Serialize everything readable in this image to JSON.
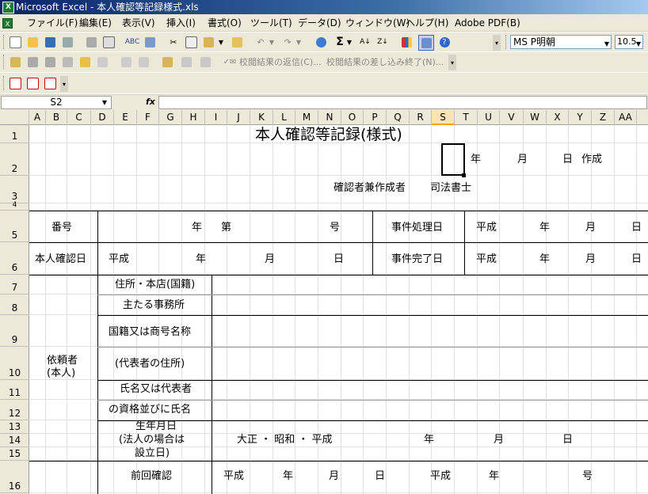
{
  "window": {
    "title": "Microsoft Excel - 本人確認等記録様式.xls",
    "app_icon": "excel-icon"
  },
  "menu": [
    "ファイル(F)",
    "編集(E)",
    "表示(V)",
    "挿入(I)",
    "書式(O)",
    "ツール(T)",
    "データ(D)",
    "ウィンドウ(W)",
    "ヘルプ(H)",
    "Adobe PDF(B)"
  ],
  "toolbar": {
    "font_name": "MS P明朝",
    "font_size": "10.5",
    "review_reply": "校閲結果の返信(C)...",
    "review_end": "校閲結果の差し込み終了(N)..."
  },
  "formula_bar": {
    "name_box": "S2",
    "fx": "fx",
    "content": ""
  },
  "columns": [
    "A",
    "B",
    "C",
    "D",
    "E",
    "F",
    "G",
    "H",
    "I",
    "J",
    "K",
    "L",
    "M",
    "N",
    "O",
    "P",
    "Q",
    "R",
    "S",
    "T",
    "U",
    "V",
    "W",
    "X",
    "Y",
    "Z",
    "AA"
  ],
  "selected_column": "S",
  "rows": [
    "1",
    "2",
    "3",
    "4",
    "5",
    "6",
    "7",
    "8",
    "9",
    "10",
    "11",
    "12",
    "13",
    "14",
    "15",
    "16"
  ],
  "sheet": {
    "title": "本人確認等記録(様式)",
    "r2": {
      "year": "年",
      "month": "月",
      "day": "日",
      "created": "作成"
    },
    "r3": {
      "confirmer": "確認者兼作成者",
      "role": "司法書士"
    },
    "r5": {
      "number": "番号",
      "year": "年",
      "dai": "第",
      "go": "号",
      "case_date": "事件処理日",
      "era": "平成",
      "y": "年",
      "m": "月",
      "d": "日"
    },
    "r6": {
      "confirm_date": "本人確認日",
      "era": "平成",
      "year": "年",
      "month": "月",
      "day": "日",
      "case_done": "事件完了日",
      "era2": "平成",
      "y": "年",
      "m": "月",
      "d": "日"
    },
    "client": {
      "line1": "依頼者",
      "line2": "(本人)"
    },
    "fields": {
      "address": "住所・本店(国籍)",
      "office": "主たる事務所",
      "nationality": "国籍又は商号名称",
      "rep_address": "(代表者の住所)",
      "name": "氏名又は代表者",
      "qual": "の資格並びに氏名",
      "dob1": "生年月日",
      "dob2": "(法人の場合は",
      "dob3": "設立日)",
      "eras": "大正 ・ 昭和 ・ 平成",
      "dob_y": "年",
      "dob_m": "月",
      "dob_d": "日"
    },
    "r16": {
      "prev": "前回確認",
      "era": "平成",
      "year": "年",
      "month": "月",
      "day": "日",
      "era2": "平成",
      "year2": "年",
      "go": "号"
    }
  }
}
